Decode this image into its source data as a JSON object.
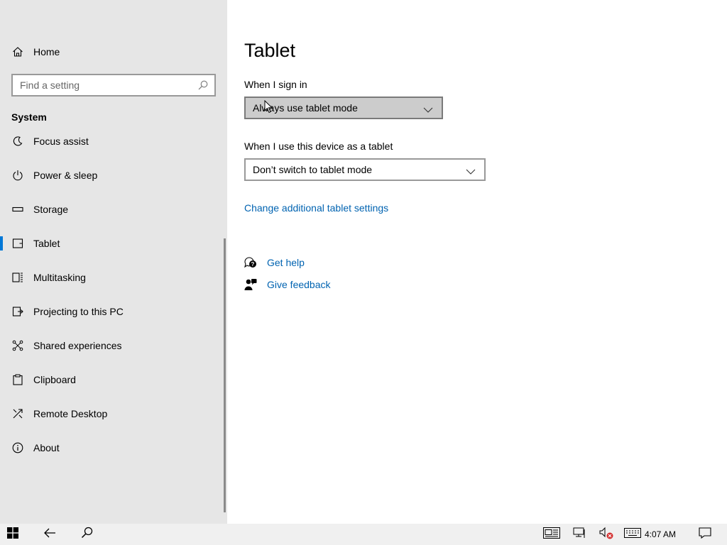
{
  "sidebar": {
    "home_label": "Home",
    "search_placeholder": "Find a setting",
    "section_title": "System",
    "items": [
      {
        "label": "Focus assist",
        "icon": "focus-assist-icon"
      },
      {
        "label": "Power & sleep",
        "icon": "power-icon"
      },
      {
        "label": "Storage",
        "icon": "storage-icon"
      },
      {
        "label": "Tablet",
        "icon": "tablet-icon",
        "active": true
      },
      {
        "label": "Multitasking",
        "icon": "multitasking-icon"
      },
      {
        "label": "Projecting to this PC",
        "icon": "projecting-icon"
      },
      {
        "label": "Shared experiences",
        "icon": "shared-experiences-icon"
      },
      {
        "label": "Clipboard",
        "icon": "clipboard-icon"
      },
      {
        "label": "Remote Desktop",
        "icon": "remote-desktop-icon"
      },
      {
        "label": "About",
        "icon": "info-icon"
      }
    ]
  },
  "main": {
    "title": "Tablet",
    "sign_in_label": "When I sign in",
    "sign_in_value": "Always use tablet mode",
    "device_label": "When I use this device as a tablet",
    "device_value": "Don’t switch to tablet mode",
    "additional_link": "Change additional tablet settings",
    "get_help": "Get help",
    "give_feedback": "Give feedback"
  },
  "taskbar": {
    "time": "4:07 AM"
  },
  "colors": {
    "accent": "#0078d7",
    "link": "#0063b1",
    "sidebar_bg": "#e6e6e6"
  }
}
